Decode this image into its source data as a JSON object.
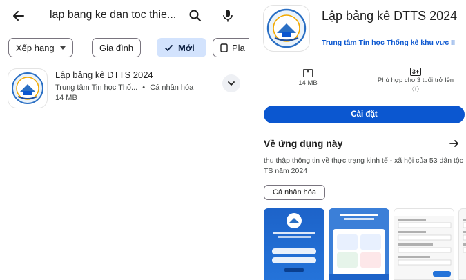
{
  "search": {
    "query": "lap bang ke dan toc thie...",
    "back_icon": "arrow-left-icon",
    "search_icon": "search-icon",
    "mic_icon": "mic-icon"
  },
  "filters": [
    {
      "label": "Xếp hạng",
      "has_dropdown": true,
      "selected": false
    },
    {
      "label": "Gia đình",
      "has_dropdown": false,
      "selected": false
    },
    {
      "label": "Mới",
      "has_dropdown": false,
      "selected": true,
      "icon": "check-icon"
    },
    {
      "label": "Pla",
      "has_dropdown": false,
      "selected": false,
      "icon": "tablet-icon"
    }
  ],
  "result": {
    "title": "Lập bảng kê DTTS 2024",
    "developer": "Trung tâm Tin học Thố...",
    "separator": "•",
    "category": "Cá nhân hóa",
    "size": "14 MB"
  },
  "detail": {
    "title": "Lập bảng kê DTTS 2024",
    "developer": "Trung tâm Tin học Thống kê khu vực II",
    "size": "14 MB",
    "age_badge": "3+",
    "age_text": "Phù hợp cho 3 tuổi trở lên",
    "info_glyph": "ⓘ",
    "install_label": "Cài đặt",
    "about_title": "Về ứng dụng này",
    "about_desc": "thu thập thông tin về thực trạng kinh tế - xã hội của 53 dân tộc TS năm 2024",
    "tag": "Cá nhân hóa"
  },
  "colors": {
    "accent": "#0b57d0",
    "chip_selected": "#d3e3fd",
    "text_primary": "#1f1f1f",
    "text_secondary": "#444746"
  }
}
